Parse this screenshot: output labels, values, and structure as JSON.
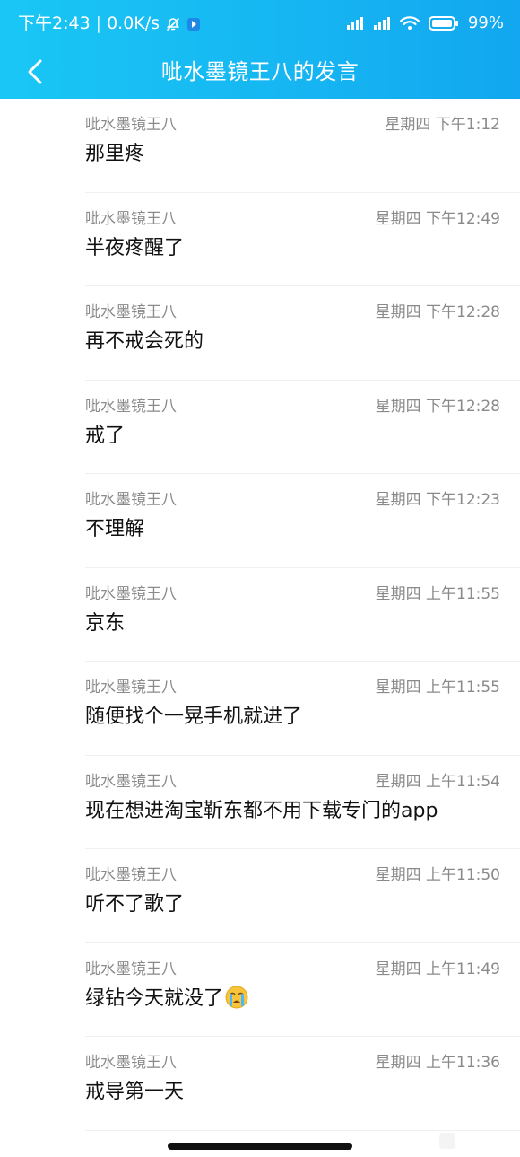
{
  "status_bar": {
    "time": "下午2:43",
    "network_speed": "0.0K/s",
    "battery": "99%"
  },
  "header": {
    "title": "呲水墨镜王八的发言"
  },
  "messages": [
    {
      "user": "呲水墨镜王八",
      "time": "星期四 下午1:12",
      "text": "那里疼"
    },
    {
      "user": "呲水墨镜王八",
      "time": "星期四 下午12:49",
      "text": "半夜疼醒了"
    },
    {
      "user": "呲水墨镜王八",
      "time": "星期四 下午12:28",
      "text": "再不戒会死的"
    },
    {
      "user": "呲水墨镜王八",
      "time": "星期四 下午12:28",
      "text": "戒了"
    },
    {
      "user": "呲水墨镜王八",
      "time": "星期四 下午12:23",
      "text": "不理解"
    },
    {
      "user": "呲水墨镜王八",
      "time": "星期四 上午11:55",
      "text": "京东"
    },
    {
      "user": "呲水墨镜王八",
      "time": "星期四 上午11:55",
      "text": "随便找个一晃手机就进了"
    },
    {
      "user": "呲水墨镜王八",
      "time": "星期四 上午11:54",
      "text": "现在想进淘宝靳东都不用下载专门的app"
    },
    {
      "user": "呲水墨镜王八",
      "time": "星期四 上午11:50",
      "text": "听不了歌了"
    },
    {
      "user": "呲水墨镜王八",
      "time": "星期四 上午11:49",
      "text": "绿钻今天就没了"
    },
    {
      "user": "呲水墨镜王八",
      "time": "星期四 上午11:36",
      "text": "戒导第一天"
    }
  ]
}
